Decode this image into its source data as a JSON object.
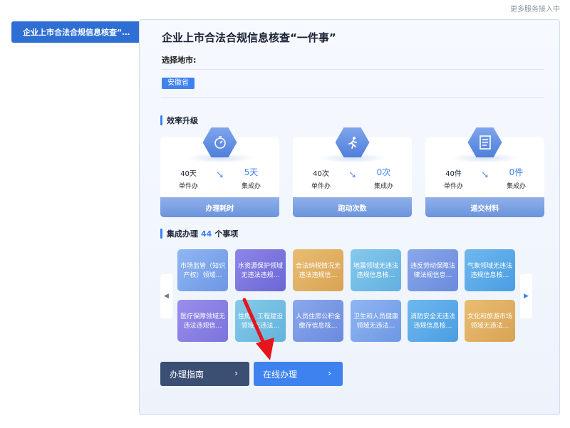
{
  "top_link": "更多服务接入中",
  "sidebar": {
    "active_tab": "企业上市合法合规信息核查“…"
  },
  "main": {
    "title": "企业上市合法合规信息核查“一件事”",
    "city_label": "选择地市:",
    "province_tag": "安徽省",
    "efficiency": {
      "heading": "效率升级",
      "cards": [
        {
          "icon": "stopwatch-icon",
          "before_value": "40天",
          "before_label": "单件办",
          "after_value": "5天",
          "after_label": "集成办",
          "footer": "办理耗时"
        },
        {
          "icon": "running-person-icon",
          "before_value": "40次",
          "before_label": "单件办",
          "after_value": "0次",
          "after_label": "集成办",
          "footer": "跑动次数"
        },
        {
          "icon": "document-icon",
          "before_value": "40件",
          "before_label": "单件办",
          "after_value": "0件",
          "after_label": "集成办",
          "footer": "递交材料"
        }
      ]
    },
    "integrated": {
      "heading_prefix": "集成办理",
      "count": "44",
      "heading_suffix": "个事项",
      "tiles": [
        "市场监管（知识产权）领域…",
        "水资源保护领域无违法违规…",
        "合法纳税情况无违法违规信…",
        "地震领域无违法违规信息核…",
        "违反劳动保障法律法规信息…",
        "气象领域无违法违规信息核…",
        "医疗保障领域无违法违规信…",
        "住房、工程建设领域无违法…",
        "人员住房公积金缴存信息核…",
        "卫生和人员健康领域无违法…",
        "消防安全无违法违规信息核…",
        "文化和旅游市场领域无违法…"
      ]
    },
    "buttons": {
      "guide": "办理指南",
      "online": "在线办理"
    }
  },
  "colors": {
    "accent": "#3e82f0",
    "sidebar_active": "#2f6fd3",
    "guide_button": "#3b4f73",
    "online_button": "#3e82f0",
    "annotation_arrow": "#e8141b"
  }
}
